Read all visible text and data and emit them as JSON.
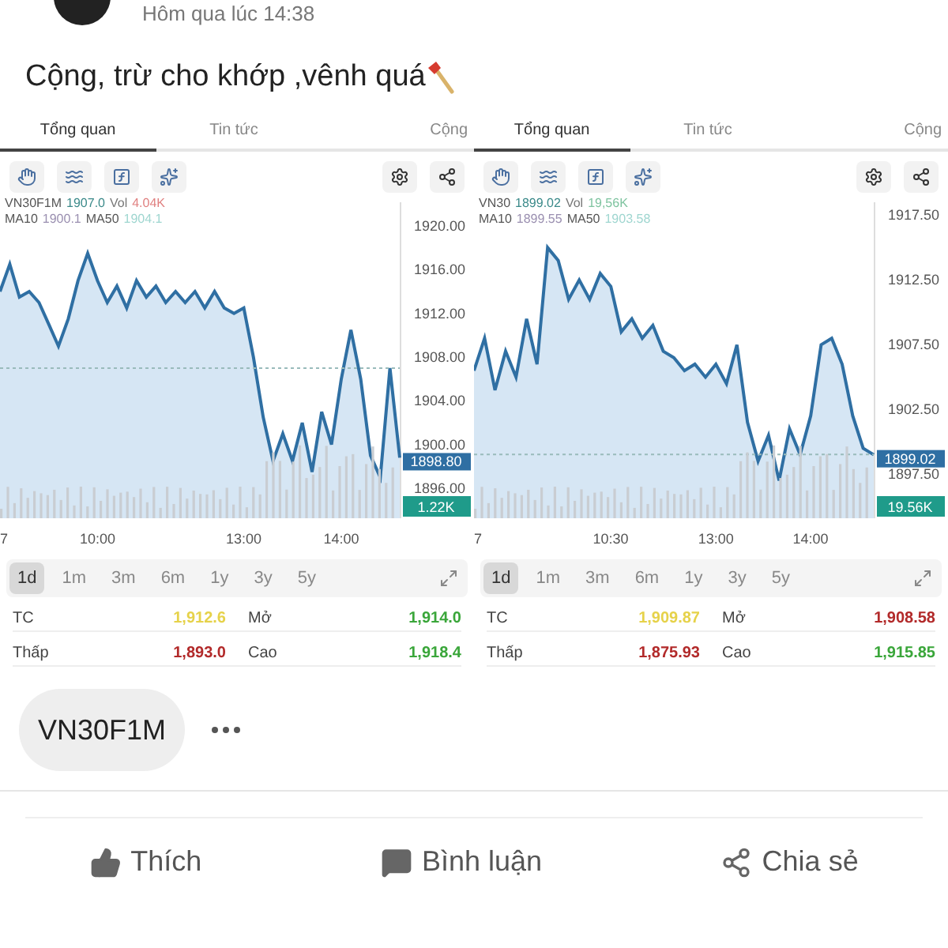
{
  "post": {
    "time": "Hôm qua lúc 14:38",
    "text": "Cộng, trừ cho khớp ,vênh quá"
  },
  "panels": [
    {
      "tabs": [
        {
          "label": "Tổng quan",
          "selected": true
        },
        {
          "label": "Tin tức",
          "selected": false
        },
        {
          "label": "Cộng",
          "selected": false
        }
      ],
      "legend": [
        [
          {
            "text": "1907.0",
            "color": "#3b8a8a"
          },
          {
            "text": "Vol",
            "color": "#777777"
          },
          {
            "text": "4.04K",
            "color": "#e08080"
          }
        ],
        [
          {
            "text": "MA10",
            "color": "#555555"
          },
          {
            "text": "1900.1",
            "color": "#9a8fb0"
          },
          {
            "text": "MA50",
            "color": "#555555"
          },
          {
            "text": "1904.1",
            "color": "#9fd6d0"
          }
        ]
      ],
      "price_tag": "1898.80",
      "volume_tag": "1.22K",
      "chart_data": {
        "type": "area",
        "categories": [
          "7",
          null,
          null,
          null,
          null,
          null,
          null,
          null,
          null,
          null,
          "10:00",
          null,
          null,
          null,
          null,
          null,
          null,
          null,
          null,
          null,
          null,
          null,
          null,
          null,
          null,
          "13:00",
          null,
          null,
          null,
          null,
          null,
          null,
          null,
          null,
          null,
          "14:00",
          null,
          null,
          null,
          null,
          null,
          null
        ],
        "series": [
          {
            "name": "VN30F1M",
            "color": "#2f6fa3",
            "values": [
              1914,
              1916.5,
              1913.5,
              1914,
              1913,
              1911,
              1909,
              1911.5,
              1915,
              1917.5,
              1915,
              1913,
              1914.5,
              1912.5,
              1915,
              1913.5,
              1914.5,
              1913,
              1914,
              1913,
              1914,
              1912.5,
              1914,
              1912.5,
              1912,
              1912.5,
              1908,
              1902.5,
              1898.5,
              1901,
              1898.5,
              1902,
              1897.5,
              1903,
              1900,
              1906,
              1910.5,
              1906,
              1899,
              1897,
              1907,
              1898.8
            ]
          }
        ],
        "ylim": [
          1893.27,
          1922.17
        ],
        "yticks": [
          {
            "value": 1920,
            "label": "1920.00"
          },
          {
            "value": 1916,
            "label": "1916.00"
          },
          {
            "value": 1912,
            "label": "1912.00"
          },
          {
            "value": 1908,
            "label": "1908.00"
          },
          {
            "value": 1904,
            "label": "1904.00"
          },
          {
            "value": 1900,
            "label": "1900.00"
          },
          {
            "value": 1896,
            "label": "1896.00"
          }
        ],
        "ref_lines": [
          {
            "axis": "y",
            "value": 1907
          }
        ]
      },
      "periods": [
        {
          "label": "1d",
          "selected": true
        },
        {
          "label": "1m",
          "selected": false
        },
        {
          "label": "3m",
          "selected": false
        },
        {
          "label": "6m",
          "selected": false
        },
        {
          "label": "1y",
          "selected": false
        },
        {
          "label": "3y",
          "selected": false
        },
        {
          "label": "5y",
          "selected": false
        }
      ],
      "stats": [
        [
          {
            "label": "TC",
            "value": "1,912.6",
            "color": "#e6d24a"
          },
          {
            "label": "Mở",
            "value": "1,914.0",
            "color": "#3aa63a"
          }
        ],
        [
          {
            "label": "Thấp",
            "value": "1,893.0",
            "color": "#b22a2a"
          },
          {
            "label": "Cao",
            "value": "1,918.4",
            "color": "#3aa63a"
          }
        ]
      ]
    },
    {
      "tabs": [
        {
          "label": "Tổng quan",
          "selected": true
        },
        {
          "label": "Tin tức",
          "selected": false
        },
        {
          "label": "Cộng",
          "selected": false
        }
      ],
      "legend": [
        [
          {
            "text": "1899.02",
            "color": "#3b8a8a"
          },
          {
            "text": "Vol",
            "color": "#777777"
          },
          {
            "text": "19,56K",
            "color": "#7fc4a0"
          }
        ],
        [
          {
            "text": "MA10",
            "color": "#555555"
          },
          {
            "text": "1899.55",
            "color": "#9a8fb0"
          },
          {
            "text": "MA50",
            "color": "#555555"
          },
          {
            "text": "1903.58",
            "color": "#9fd6d0"
          }
        ]
      ],
      "price_tag": "1899.02",
      "volume_tag": "19.56K",
      "chart_data": {
        "type": "area",
        "categories": [
          "7",
          null,
          null,
          null,
          null,
          null,
          null,
          null,
          null,
          null,
          null,
          null,
          null,
          "10:30",
          null,
          null,
          null,
          null,
          null,
          null,
          null,
          null,
          null,
          "13:00",
          null,
          null,
          null,
          null,
          null,
          null,
          null,
          null,
          "14:00",
          null,
          null,
          null,
          null,
          null,
          null
        ],
        "series": [
          {
            "name": "VN30",
            "color": "#2f6fa3",
            "values": [
              1905.5,
              1908,
              1904,
              1907,
              1905,
              1909.5,
              1906,
              1915,
              1914,
              1911,
              1912.5,
              1911,
              1913,
              1912,
              1908.5,
              1909.5,
              1908,
              1909,
              1907,
              1906.5,
              1905.5,
              1906,
              1905,
              1906,
              1904.5,
              1907.5,
              1901.5,
              1898.5,
              1900.5,
              1897,
              1901,
              1899,
              1902,
              1907.5,
              1908,
              1906,
              1902,
              1899.5,
              1899
            ]
          }
        ],
        "ylim": [
          1894.1,
          1918.5
        ],
        "yticks": [
          {
            "value": 1917.5,
            "label": "1917.50"
          },
          {
            "value": 1912.5,
            "label": "1912.50"
          },
          {
            "value": 1907.5,
            "label": "1907.50"
          },
          {
            "value": 1902.5,
            "label": "1902.50"
          },
          {
            "value": 1897.5,
            "label": "1897.50"
          }
        ],
        "ref_lines": [
          {
            "axis": "y",
            "value": 1899.02
          }
        ]
      },
      "periods": [
        {
          "label": "1d",
          "selected": true
        },
        {
          "label": "1m",
          "selected": false
        },
        {
          "label": "3m",
          "selected": false
        },
        {
          "label": "6m",
          "selected": false
        },
        {
          "label": "1y",
          "selected": false
        },
        {
          "label": "3y",
          "selected": false
        },
        {
          "label": "5y",
          "selected": false
        }
      ],
      "stats": [
        [
          {
            "label": "TC",
            "value": "1,909.87",
            "color": "#e6d24a"
          },
          {
            "label": "Mở",
            "value": "1,908.58",
            "color": "#b22a2a"
          }
        ],
        [
          {
            "label": "Thấp",
            "value": "1,875.93",
            "color": "#b22a2a"
          },
          {
            "label": "Cao",
            "value": "1,915.85",
            "color": "#3aa63a"
          }
        ]
      ]
    }
  ],
  "tag": "VN30F1M",
  "actions": [
    {
      "kind": "like",
      "label": "Thích"
    },
    {
      "kind": "comment",
      "label": "Bình luận"
    },
    {
      "kind": "share",
      "label": "Chia sẻ"
    }
  ]
}
